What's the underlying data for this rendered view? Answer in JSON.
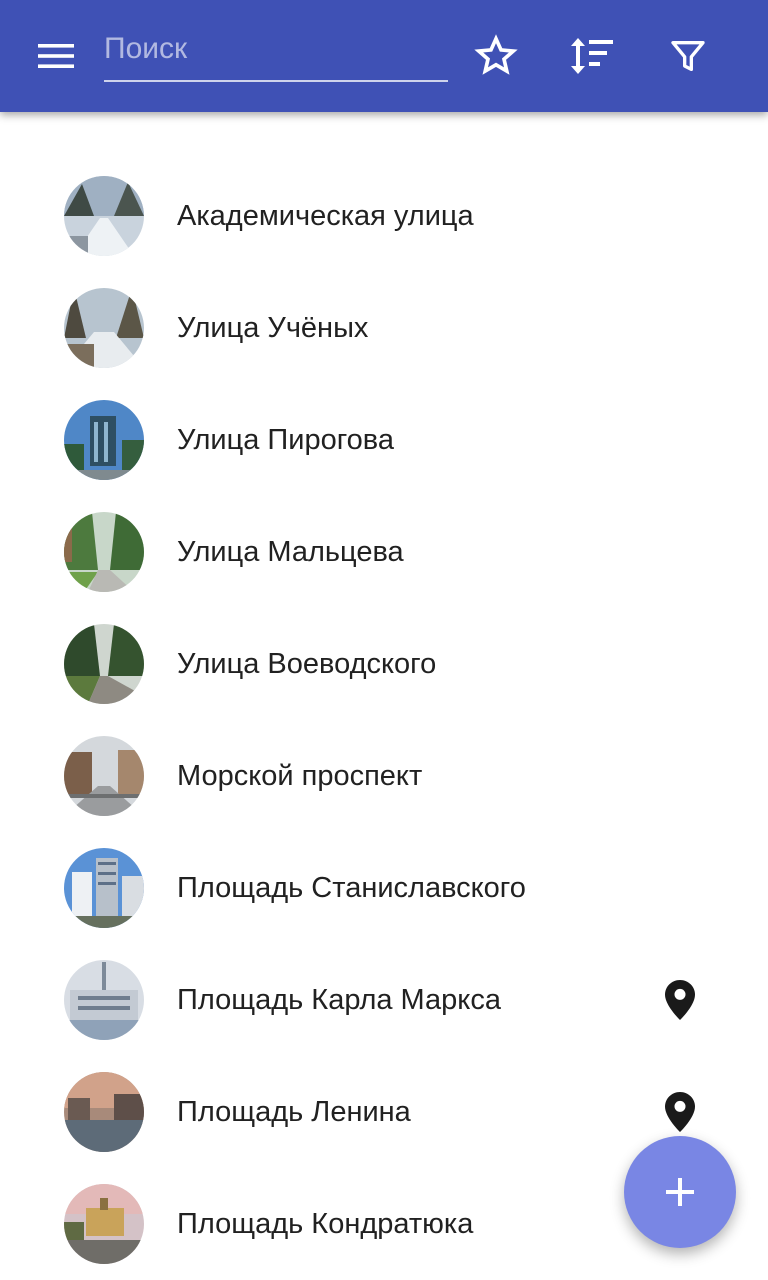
{
  "header": {
    "menu_icon": "menu-icon",
    "search_placeholder": "Поиск",
    "search_value": "",
    "favorite_icon": "star-outline-icon",
    "sort_icon": "sort-icon",
    "filter_icon": "filter-icon",
    "background_color": "#3f51b5"
  },
  "places": [
    {
      "name": "Академическая улица",
      "has_location": false,
      "thumb": "winter-road"
    },
    {
      "name": "Улица Учёных",
      "has_location": false,
      "thumb": "snowy-forest"
    },
    {
      "name": "Улица Пирогова",
      "has_location": false,
      "thumb": "glass-building"
    },
    {
      "name": "Улица Мальцева",
      "has_location": false,
      "thumb": "green-alley"
    },
    {
      "name": "Улица Воеводского",
      "has_location": false,
      "thumb": "forest-road"
    },
    {
      "name": "Морской проспект",
      "has_location": false,
      "thumb": "avenue"
    },
    {
      "name": "Площадь Станиславского",
      "has_location": false,
      "thumb": "high-rise"
    },
    {
      "name": "Площадь Карла Маркса",
      "has_location": true,
      "thumb": "square-tower"
    },
    {
      "name": "Площадь Ленина",
      "has_location": true,
      "thumb": "evening-square"
    },
    {
      "name": "Площадь Кондратюка",
      "has_location": false,
      "thumb": "sunset-square"
    }
  ],
  "fab": {
    "icon": "plus-icon",
    "color": "#7986e4"
  },
  "location_icon": "location-pin-icon"
}
